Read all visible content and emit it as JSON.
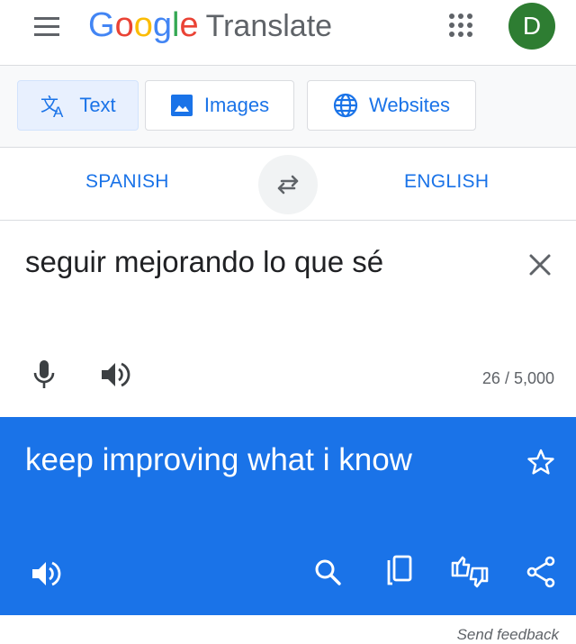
{
  "header": {
    "logo_letters": [
      {
        "char": "G",
        "color": "#4285f4"
      },
      {
        "char": "o",
        "color": "#ea4335"
      },
      {
        "char": "o",
        "color": "#fbbc05"
      },
      {
        "char": "g",
        "color": "#4285f4"
      },
      {
        "char": "l",
        "color": "#34a853"
      },
      {
        "char": "e",
        "color": "#ea4335"
      }
    ],
    "product_name": "Translate",
    "menu_icon": "hamburger-menu-icon",
    "apps_icon": "apps-grid-icon",
    "avatar_letter": "D",
    "avatar_color": "#2e7d32"
  },
  "tabs": [
    {
      "label": "Text",
      "icon": "translate-icon",
      "active": true
    },
    {
      "label": "Images",
      "icon": "image-icon",
      "active": false
    },
    {
      "label": "Websites",
      "icon": "globe-icon",
      "active": false
    }
  ],
  "languages": {
    "source": "SPANISH",
    "target": "ENGLISH",
    "swap_icon": "swap-arrows-icon"
  },
  "source": {
    "text": "seguir mejorando lo que sé",
    "char_count": "26 / 5,000",
    "clear_icon": "close-icon",
    "mic_icon": "microphone-icon",
    "listen_icon": "speaker-icon"
  },
  "result": {
    "text": "keep improving what i know",
    "background": "#1a73e8",
    "star_icon": "star-outline-icon",
    "listen_icon": "speaker-icon",
    "search_icon": "search-icon",
    "copy_icon": "copy-icon",
    "feedback_icon": "rate-translation-icon",
    "share_icon": "share-icon"
  },
  "footer": {
    "send_feedback": "Send feedback"
  },
  "colors": {
    "accent": "#1a73e8",
    "text": "#202124",
    "secondary_text": "#5f6368",
    "divider": "#dadce0"
  }
}
